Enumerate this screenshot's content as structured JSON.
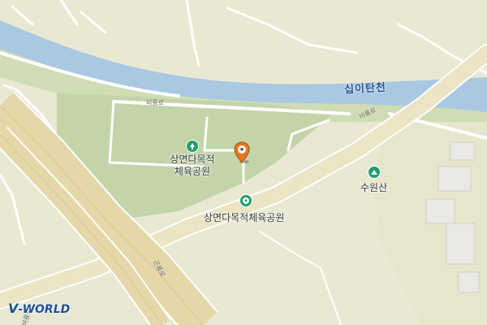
{
  "map": {
    "labels": {
      "river": "십이탄천",
      "road_birong_1": "비룡로",
      "road_birong_2": "비룡로",
      "road_lower": "곤룡로",
      "road_left": "비룡로",
      "park_line1": "상면다목적",
      "park_line2": "체육공원",
      "mountain": "수원산",
      "sports_park": "상면다목적체육공원"
    },
    "icons": {
      "park": "park-tree-icon",
      "mountain": "mountain-icon",
      "sports": "soccer-ball-icon",
      "marker": "location-pin-icon"
    },
    "colors": {
      "land": "#e9e8d2",
      "river": "#a9c8e2",
      "riverbank": "#c9dbb0",
      "park": "#c3d4a8",
      "road": "#ffffff",
      "expressway": "#e4d7a8",
      "poi": "#1f9e6b",
      "marker": "#e8761c"
    },
    "logo": {
      "prefix": "V",
      "rest": "-WORLD"
    }
  }
}
